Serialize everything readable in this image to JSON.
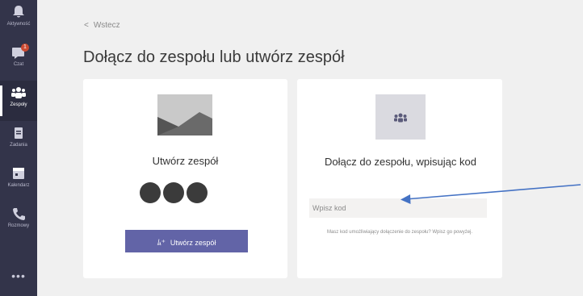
{
  "rail": {
    "items": [
      {
        "label": "Aktywność",
        "icon": "bell-icon"
      },
      {
        "label": "Czat",
        "icon": "chat-icon",
        "badge": "1"
      },
      {
        "label": "Zespoły",
        "icon": "teams-icon",
        "active": true
      },
      {
        "label": "Zadania",
        "icon": "assignments-icon"
      },
      {
        "label": "Kalendarz",
        "icon": "calendar-icon"
      },
      {
        "label": "Rozmowy",
        "icon": "phone-icon"
      }
    ],
    "more": "•••"
  },
  "header": {
    "back_label": "Wstecz",
    "title": "Dołącz do zespołu lub utwórz zespół"
  },
  "create_card": {
    "title": "Utwórz zespół",
    "button_label": "Utwórz zespół"
  },
  "join_card": {
    "title": "Dołącz do zespołu, wpisując kod",
    "input_placeholder": "Wpisz kod",
    "hint": "Masz kod umożliwiający dołączenie do zespołu? Wpisz go powyżej."
  },
  "colors": {
    "rail": "#33344a",
    "accent": "#6264a7",
    "arrow": "#4472c4"
  }
}
